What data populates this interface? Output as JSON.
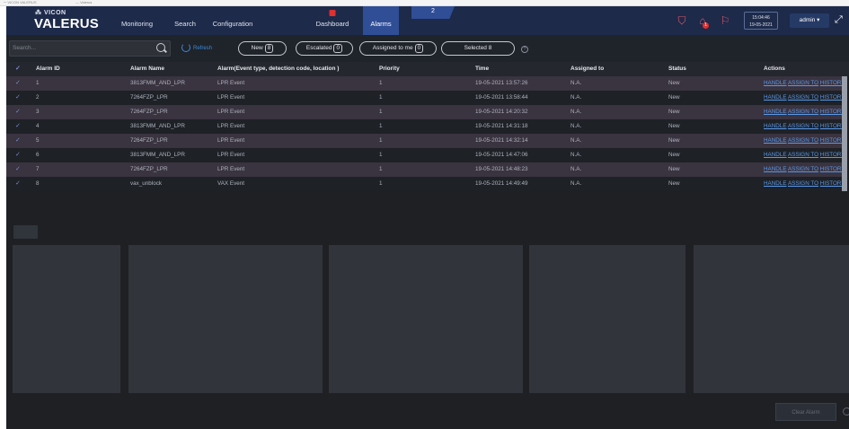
{
  "browser": {
    "tab1": "ꟷ  VICON VALERUS",
    "tab2": "— Valerus"
  },
  "app": {
    "brand_top": "⁂ VICON",
    "brand_name": "VALERUS"
  },
  "nav": {
    "items": [
      "Monitoring",
      "Search",
      "Configuration",
      "",
      "Dashboard",
      "Alarms"
    ],
    "alarm_count": "2",
    "active_index": 5
  },
  "header_right": {
    "date": "19-05-2021",
    "time": "15:04:46",
    "user": "admin ▾",
    "notification_badge": "1"
  },
  "toolbar": {
    "search_placeholder": "Search...",
    "refresh_label": "Refresh",
    "filters": [
      {
        "label": "New",
        "count": "8"
      },
      {
        "label": "Escalated",
        "count": "0"
      },
      {
        "label": "Assigned to me",
        "count": "0"
      },
      {
        "label": "Selected",
        "count": "8"
      }
    ]
  },
  "table": {
    "columns": [
      "Alarm ID",
      "Alarm Name",
      "Alarm(Event type, detection code, location )",
      "Priority",
      "Time",
      "Assigned to",
      "Status",
      "Actions"
    ],
    "rows": [
      {
        "id": "1",
        "name": "3813FMM_AND_LPR",
        "event": "LPR Event",
        "priority": "1",
        "time": "19-05-2021 13:57:26",
        "assigned": "N.A.",
        "status": "New"
      },
      {
        "id": "2",
        "name": "7264FZP_LPR",
        "event": "LPR Event",
        "priority": "1",
        "time": "19-05-2021 13:58:44",
        "assigned": "N.A.",
        "status": "New"
      },
      {
        "id": "3",
        "name": "7264FZP_LPR",
        "event": "LPR Event",
        "priority": "1",
        "time": "19-05-2021 14:20:32",
        "assigned": "N.A.",
        "status": "New"
      },
      {
        "id": "4",
        "name": "3813FMM_AND_LPR",
        "event": "LPR Event",
        "priority": "1",
        "time": "19-05-2021 14:31:18",
        "assigned": "N.A.",
        "status": "New"
      },
      {
        "id": "5",
        "name": "7264FZP_LPR",
        "event": "LPR Event",
        "priority": "1",
        "time": "19-05-2021 14:32:14",
        "assigned": "N.A.",
        "status": "New"
      },
      {
        "id": "6",
        "name": "3813FMM_AND_LPR",
        "event": "LPR Event",
        "priority": "1",
        "time": "19-05-2021 14:47:06",
        "assigned": "N.A.",
        "status": "New"
      },
      {
        "id": "7",
        "name": "7264FZP_LPR",
        "event": "LPR Event",
        "priority": "1",
        "time": "19-05-2021 14:48:23",
        "assigned": "N.A.",
        "status": "New"
      },
      {
        "id": "8",
        "name": "vax_unblock",
        "event": "VAX Event",
        "priority": "1",
        "time": "19-05-2021 14:49:49",
        "assigned": "N.A.",
        "status": "New"
      }
    ],
    "actions": [
      "HANDLE",
      "ASSIGN TO",
      "HISTORY"
    ]
  },
  "footer": {
    "button_label": "Clear Alarm"
  },
  "colors": {
    "header": "#1d2a4a",
    "active_tab": "#2f4e96",
    "link": "#5a98e6",
    "row_even": "#3a3340",
    "row_odd": "#1e2126",
    "badge": "#e03030"
  }
}
